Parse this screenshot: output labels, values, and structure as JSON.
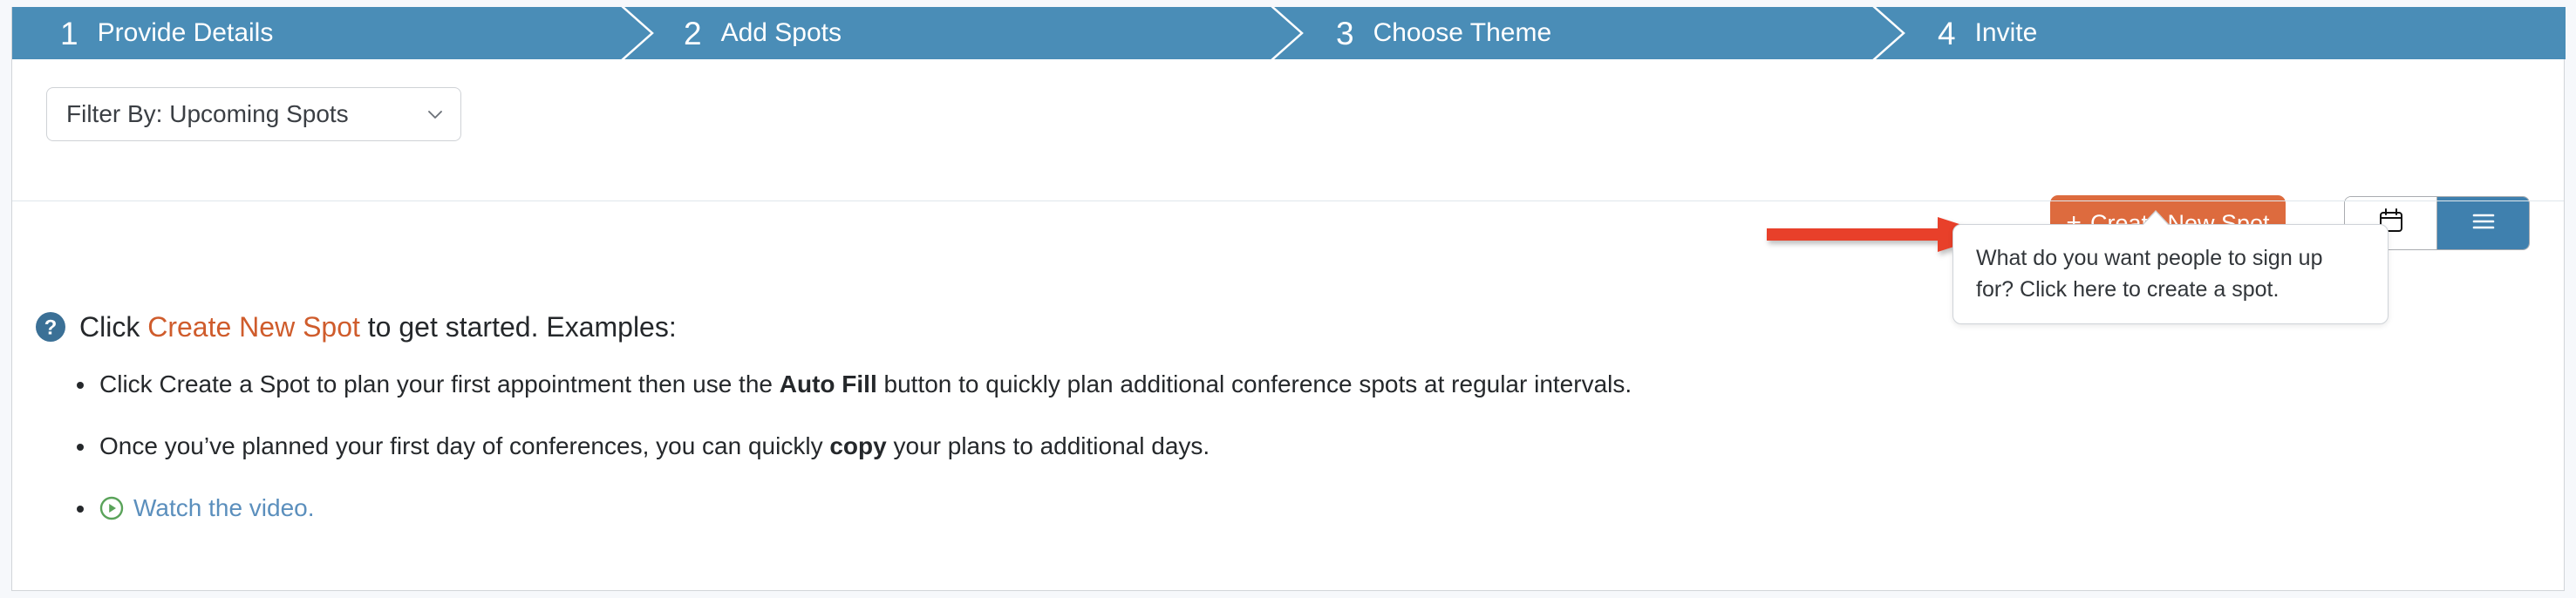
{
  "wizard": {
    "steps": [
      {
        "num": "1",
        "label": "Provide Details"
      },
      {
        "num": "2",
        "label": "Add Spots"
      },
      {
        "num": "3",
        "label": "Choose Theme"
      },
      {
        "num": "4",
        "label": "Invite"
      }
    ],
    "active_color": "#4a8db7"
  },
  "toolbar": {
    "filter": {
      "value": "Filter By: Upcoming Spots",
      "icon": "chevron-down-icon"
    },
    "create_button": {
      "plus": "+",
      "label": "Create New Spot",
      "color": "#dd6b3e"
    },
    "view_toggle": {
      "calendar_icon": "calendar-icon",
      "list_icon": "list-icon",
      "active": "list",
      "active_color": "#3f80ae"
    },
    "annotation_arrow": {
      "name": "red-arrow-annotation",
      "color": "#e8402a",
      "direction": "right"
    }
  },
  "tooltip": {
    "text": "What do you want people to sign up for? Click here to create a spot."
  },
  "content": {
    "intro": {
      "icon": "question-mark-icon",
      "before": "Click ",
      "link": "Create New Spot",
      "after": " to get started. Examples:",
      "link_color": "#cf5c2c"
    },
    "bullets": [
      {
        "parts": [
          {
            "text": "Click Create a Spot to plan your first appointment then use the ",
            "bold": false
          },
          {
            "text": "Auto Fill",
            "bold": true
          },
          {
            "text": " button to quickly plan additional conference spots at regular intervals.",
            "bold": false
          }
        ]
      },
      {
        "parts": [
          {
            "text": "Once you’ve planned your first day of conferences, you can quickly ",
            "bold": false
          },
          {
            "text": "copy",
            "bold": true
          },
          {
            "text": " your plans to additional days.",
            "bold": false
          }
        ]
      }
    ],
    "video": {
      "icon": "play-circle-icon",
      "label": "Watch the video.",
      "link_color": "#5b8fbd",
      "icon_color": "#5aa35a"
    }
  }
}
